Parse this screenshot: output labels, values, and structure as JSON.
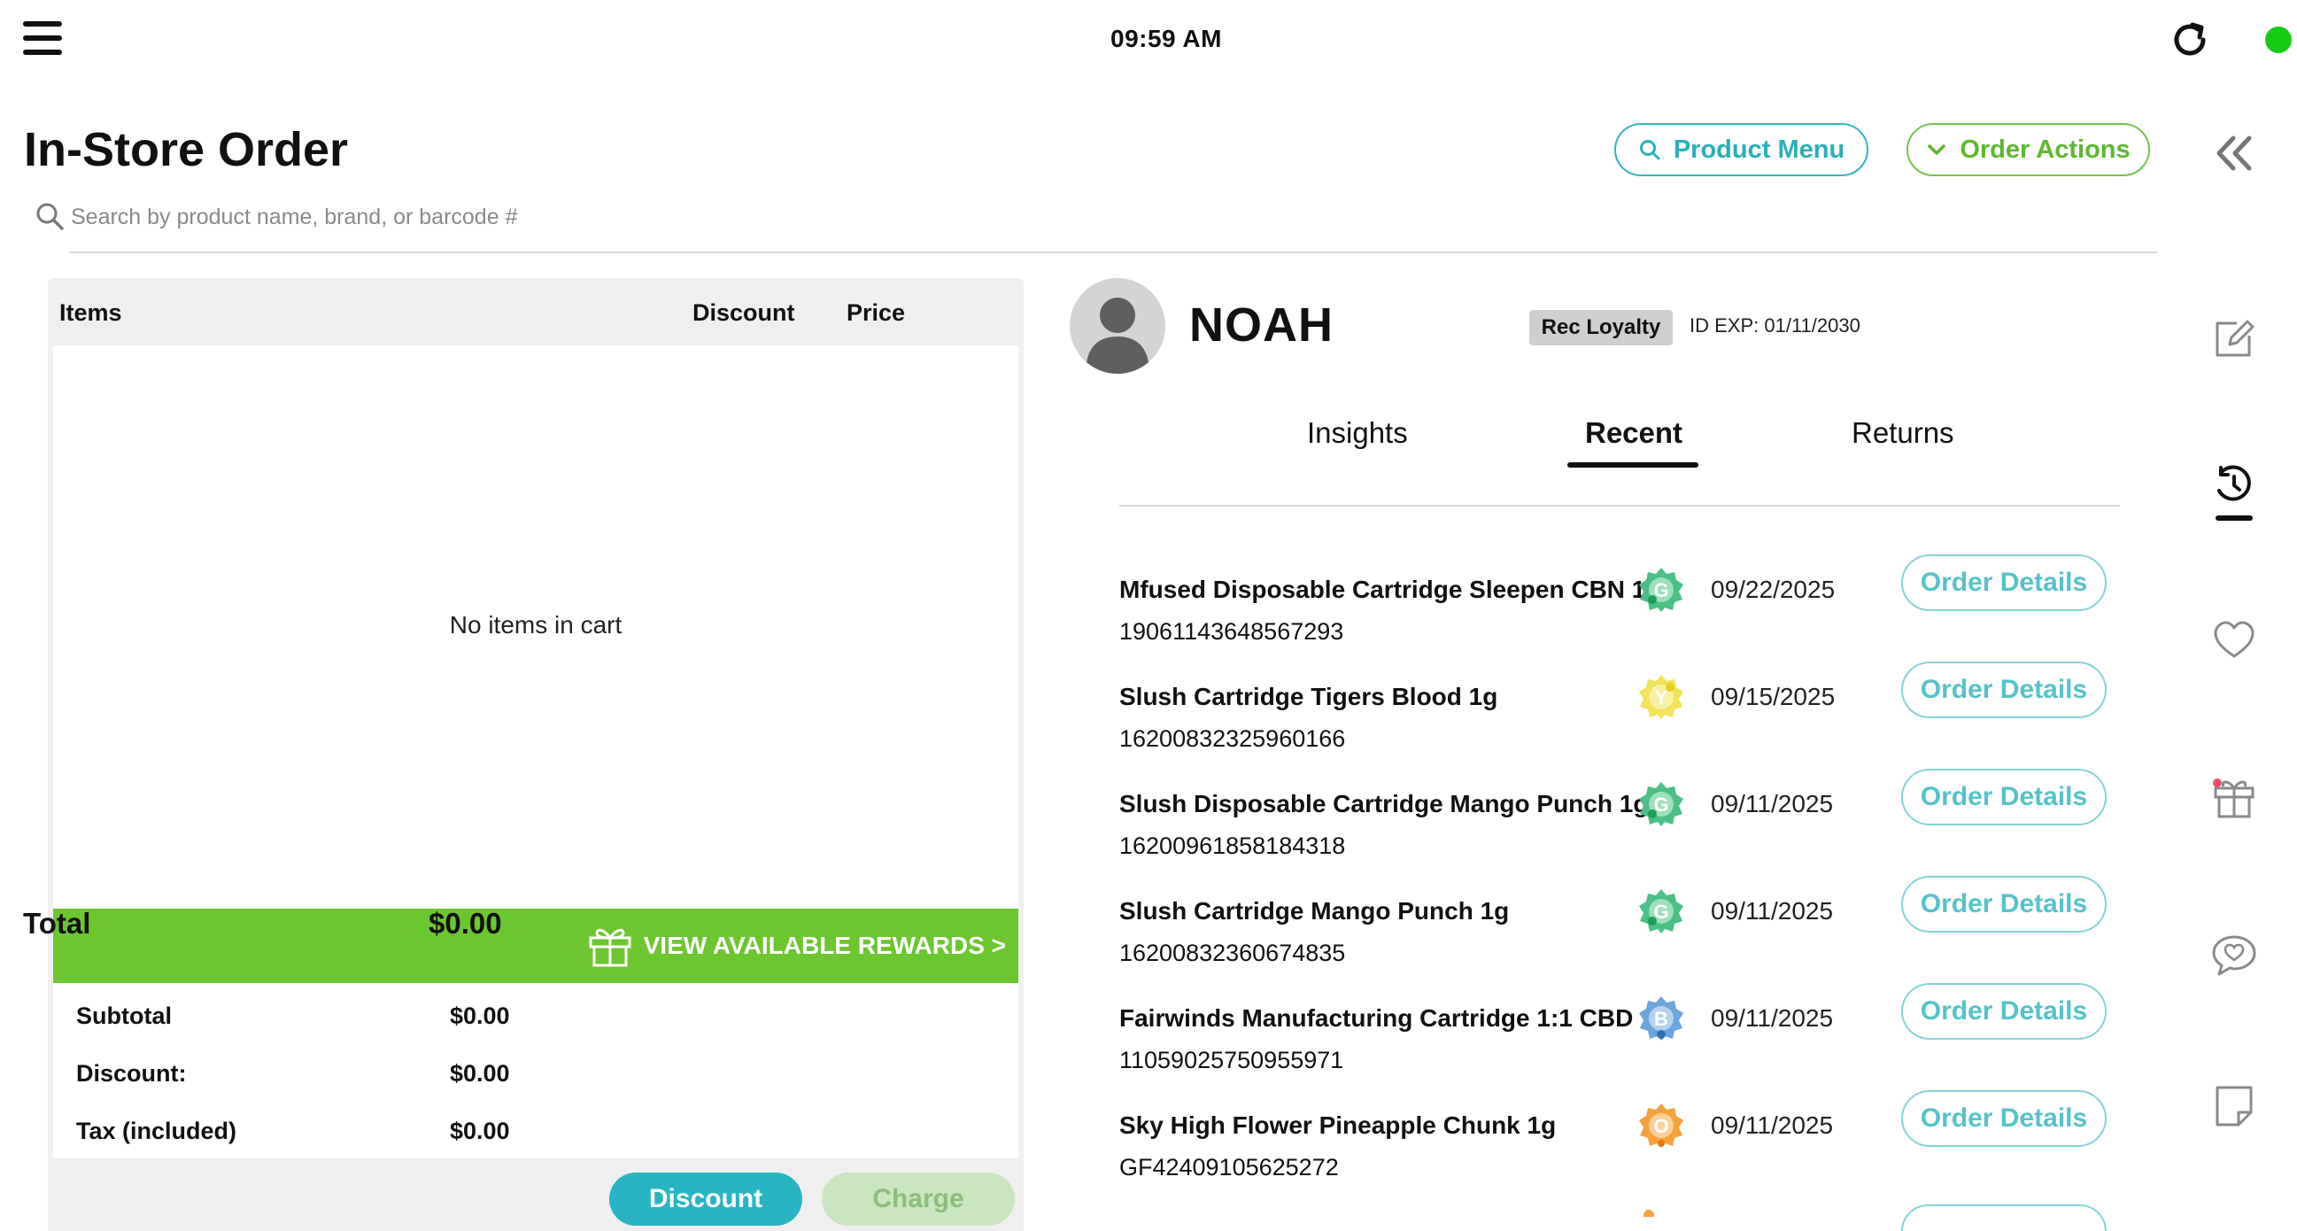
{
  "status_bar": {
    "time": "09:59 AM"
  },
  "header": {
    "title": "In-Store Order",
    "product_menu_label": "Product Menu",
    "order_actions_label": "Order Actions"
  },
  "search": {
    "placeholder": "Search by product name, brand, or barcode #"
  },
  "cart": {
    "columns": {
      "items": "Items",
      "discount": "Discount",
      "price": "Price"
    },
    "empty_message": "No items in cart",
    "rewards_label": "VIEW AVAILABLE REWARDS >",
    "summary": {
      "subtotal_label": "Subtotal",
      "subtotal_value": "$0.00",
      "discount_label": "Discount:",
      "discount_value": "$0.00",
      "tax_label": "Tax (included)",
      "tax_value": "$0.00",
      "total_label": "Total",
      "total_value": "$0.00"
    },
    "discount_button": "Discount",
    "charge_button": "Charge"
  },
  "customer": {
    "name": "NOAH",
    "loyalty": "Rec Loyalty",
    "id_exp": "ID EXP: 01/11/2030"
  },
  "tabs": [
    {
      "label": "Insights"
    },
    {
      "label": "Recent",
      "active": true
    },
    {
      "label": "Returns"
    }
  ],
  "recent_orders": [
    {
      "name": "Mfused Disposable Cartridge Sleepen CBN 1g",
      "sku": "19061143648567293",
      "badge": "G",
      "badge_color": "#4cbf86",
      "date": "09/22/2025",
      "button": "Order Details"
    },
    {
      "name": "Slush Cartridge Tigers Blood 1g",
      "sku": "16200832325960166",
      "badge": "Y",
      "badge_color": "#f1e35a",
      "date": "09/15/2025",
      "button": "Order Details"
    },
    {
      "name": "Slush Disposable Cartridge Mango Punch 1g",
      "sku": "16200961858184318",
      "badge": "G",
      "badge_color": "#4cbf86",
      "date": "09/11/2025",
      "button": "Order Details"
    },
    {
      "name": "Slush Cartridge Mango Punch 1g",
      "sku": "16200832360674835",
      "badge": "G",
      "badge_color": "#4cbf86",
      "date": "09/11/2025",
      "button": "Order Details"
    },
    {
      "name": "Fairwinds Manufacturing Cartridge 1:1 CBD 1g",
      "sku": "11059025750955971",
      "badge": "B",
      "badge_color": "#6aa6dd",
      "date": "09/11/2025",
      "button": "Order Details"
    },
    {
      "name": "Sky High Flower Pineapple Chunk 1g",
      "sku": "GF42409105625272",
      "badge": "O",
      "badge_color": "#f6a23a",
      "date": "09/11/2025",
      "button": "Order Details"
    }
  ],
  "colors": {
    "teal": "#27b5c3",
    "green": "#6cc62f",
    "status_online": "#16cc12"
  },
  "icons": [
    "menu-icon",
    "refresh-icon",
    "search-icon",
    "chevron-down-icon",
    "double-chevron-left-icon",
    "gift-icon",
    "edit-icon",
    "history-icon",
    "heart-icon",
    "chat-heart-icon",
    "note-icon",
    "avatar-icon"
  ]
}
